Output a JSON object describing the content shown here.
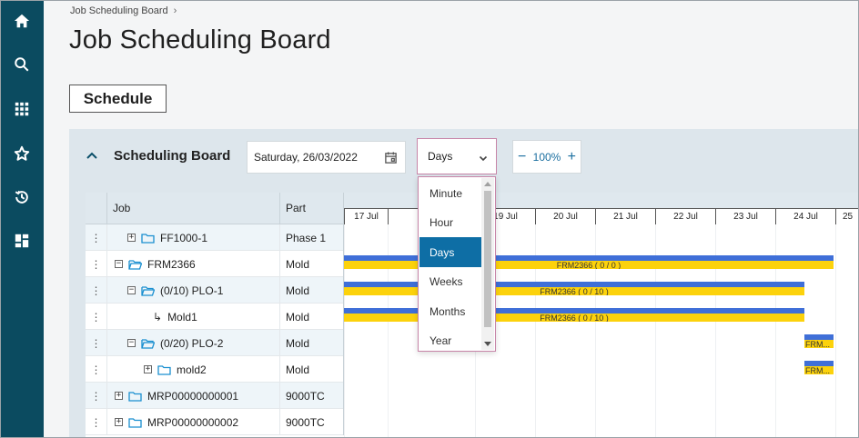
{
  "colors": {
    "rail": "#0b4b60",
    "accent": "#0e6ea5",
    "bar_blue": "#3f6fd8",
    "bar_yellow": "#fcd20c",
    "select_border": "#c785a8"
  },
  "rail": {
    "items": [
      {
        "icon": "home-icon"
      },
      {
        "icon": "search-icon"
      },
      {
        "icon": "apps-grid-icon"
      },
      {
        "icon": "star-icon"
      },
      {
        "icon": "history-icon"
      },
      {
        "icon": "dashboard-icon"
      }
    ]
  },
  "breadcrumb": {
    "item": "Job Scheduling Board",
    "separator": "›"
  },
  "page": {
    "title": "Job Scheduling Board"
  },
  "tabs": {
    "schedule": "Schedule"
  },
  "board": {
    "title": "Scheduling Board",
    "date": "Saturday, 26/03/2022",
    "view": "Days",
    "zoom": "100%",
    "zoom_minus": "−",
    "zoom_plus": "+"
  },
  "dropdown": {
    "options": [
      "Minute",
      "Hour",
      "Days",
      "Weeks",
      "Months",
      "Year"
    ],
    "selected": "Days"
  },
  "grid": {
    "headers": {
      "job": "Job",
      "part": "Part"
    },
    "days": [
      "17 Jul",
      "",
      "19 Jul",
      "20 Jul",
      "21 Jul",
      "22 Jul",
      "23 Jul",
      "24 Jul",
      "25"
    ],
    "rows": [
      {
        "indent": 1,
        "expander": "+",
        "kind": "folder",
        "job": "FF1000-1",
        "part": "Phase 1"
      },
      {
        "indent": 0,
        "expander": "−",
        "kind": "folder-open",
        "job": "FRM2366",
        "part": "Mold"
      },
      {
        "indent": 1,
        "expander": "−",
        "kind": "folder-open",
        "job": "(0/10) PLO-1",
        "part": "Mold"
      },
      {
        "indent": 2,
        "expander": "",
        "kind": "sub",
        "job": "Mold1",
        "part": "Mold"
      },
      {
        "indent": 1,
        "expander": "−",
        "kind": "folder-open",
        "job": "(0/20) PLO-2",
        "part": "Mold"
      },
      {
        "indent": 2,
        "expander": "+",
        "kind": "folder",
        "job": "mold2",
        "part": "Mold"
      },
      {
        "indent": 0,
        "expander": "+",
        "kind": "folder",
        "job": "MRP00000000001",
        "part": "9000TC"
      },
      {
        "indent": 0,
        "expander": "+",
        "kind": "folder",
        "job": "MRP00000000002",
        "part": "9000TC"
      }
    ],
    "bars": [
      {
        "row": 1,
        "label": "FRM2366 ( 0 / 0 )"
      },
      {
        "row": 2,
        "label": "FRM2366 ( 0 / 10 )"
      },
      {
        "row": 3,
        "label": "FRM2366 ( 0 / 10 )"
      },
      {
        "row": 4,
        "label": "FRM..."
      },
      {
        "row": 5,
        "label": "FRM..."
      }
    ]
  }
}
